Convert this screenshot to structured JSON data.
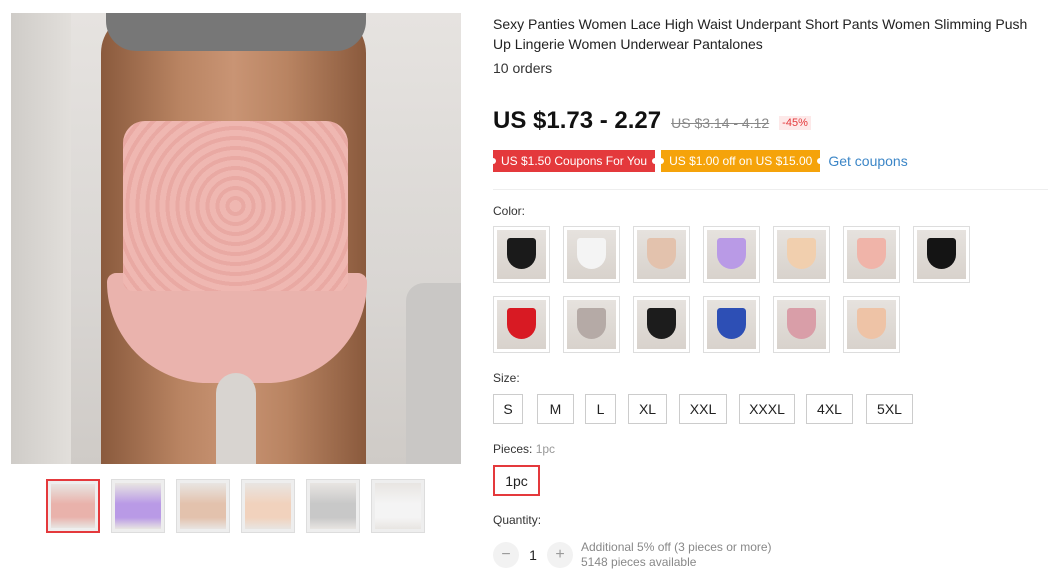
{
  "product": {
    "title": "Sexy Panties Women Lace High Waist Underpant Short Pants Women Slimming Push Up Lingerie Women Underwear Pantalones",
    "orders": "10 orders"
  },
  "price": {
    "current": "US $1.73 - 2.27",
    "original": "US $3.14 - 4.12",
    "discount": "-45%"
  },
  "coupons": {
    "red_label": "US $1.50 Coupons For You",
    "orange_label": "US $1.00 off on US $15.00",
    "link": "Get coupons"
  },
  "color": {
    "label": "Color:",
    "options": [
      {
        "color": "#1a1a1a"
      },
      {
        "color": "#f4f4f4"
      },
      {
        "color": "#e3c2ad"
      },
      {
        "color": "#b99ae6"
      },
      {
        "color": "#f1cfae"
      },
      {
        "color": "#f0b4a9"
      },
      {
        "color": "#141414"
      },
      {
        "color": "#d81a23"
      },
      {
        "color": "#b5aaa6"
      },
      {
        "color": "#1c1c1c"
      },
      {
        "color": "#2d4fb5"
      },
      {
        "color": "#d99ea8"
      },
      {
        "color": "#eec3a6"
      }
    ]
  },
  "size": {
    "label": "Size:",
    "options": [
      "S",
      "M",
      "L",
      "XL",
      "XXL",
      "XXXL",
      "4XL",
      "5XL"
    ]
  },
  "pieces": {
    "label": "Pieces:",
    "selected": "1pc",
    "options": [
      "1pc"
    ]
  },
  "quantity": {
    "label": "Quantity:",
    "value": "1",
    "minus": "−",
    "plus": "+",
    "discount_note": "Additional 5% off (3 pieces or more)",
    "available": "5148 pieces available"
  },
  "gallery": {
    "thumbnails": [
      {
        "tone": "#e9b2ab"
      },
      {
        "tone": "#b99ae6"
      },
      {
        "tone": "#e3c2ad"
      },
      {
        "tone": "#f1d2bd"
      },
      {
        "tone": "#c8c8c8"
      },
      {
        "tone": "#f4f4f4"
      }
    ]
  }
}
